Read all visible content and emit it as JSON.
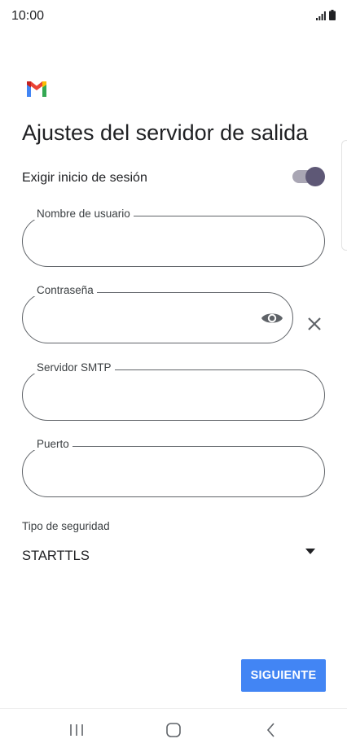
{
  "status_bar": {
    "time": "10:00",
    "icons": [
      "signal-icon",
      "battery-icon"
    ]
  },
  "app": {
    "logo": "gmail-logo-icon",
    "title": "Ajustes del servidor de salida"
  },
  "login_toggle": {
    "label": "Exigir inicio de sesión",
    "state": "on"
  },
  "fields": {
    "username": {
      "label": "Nombre de usuario",
      "value": ""
    },
    "password": {
      "label": "Contraseña",
      "value": "",
      "show_icon": "eye-icon"
    },
    "smtp_server": {
      "label": "Servidor SMTP",
      "value": ""
    },
    "port": {
      "label": "Puerto",
      "value": ""
    }
  },
  "security": {
    "label": "Tipo de seguridad",
    "value": "STARTTLS"
  },
  "next_button": {
    "label": "SIGUIENTE"
  },
  "colors": {
    "accent_button": "#4285f4",
    "toggle_knob": "#5e5876",
    "toggle_track": "#a9a6b4",
    "field_border": "#5f6368"
  },
  "nav_bar": {
    "buttons": [
      "recent-apps-icon",
      "home-icon",
      "back-icon"
    ]
  }
}
